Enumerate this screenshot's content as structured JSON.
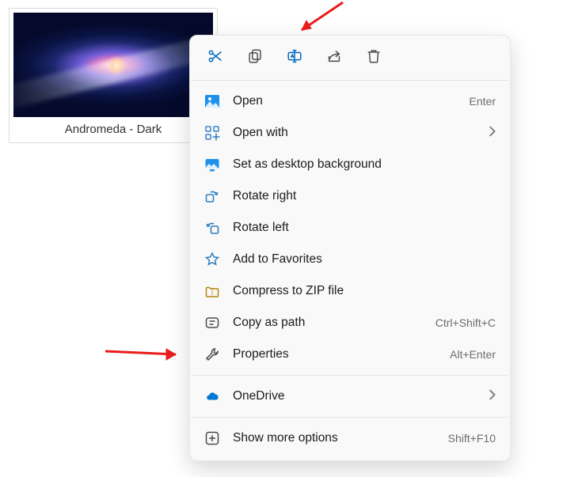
{
  "file": {
    "name": "Andromeda - Dark"
  },
  "toolbar": {
    "cut": "Cut",
    "copy": "Copy",
    "rename": "Rename",
    "share": "Share",
    "delete": "Delete"
  },
  "menu": {
    "open": {
      "label": "Open",
      "accel": "Enter"
    },
    "open_with": {
      "label": "Open with"
    },
    "set_bg": {
      "label": "Set as desktop background"
    },
    "rotate_r": {
      "label": "Rotate right"
    },
    "rotate_l": {
      "label": "Rotate left"
    },
    "favorites": {
      "label": "Add to Favorites"
    },
    "zip": {
      "label": "Compress to ZIP file"
    },
    "copy_path": {
      "label": "Copy as path",
      "accel": "Ctrl+Shift+C"
    },
    "properties": {
      "label": "Properties",
      "accel": "Alt+Enter"
    },
    "onedrive": {
      "label": "OneDrive"
    },
    "more": {
      "label": "Show more options",
      "accel": "Shift+F10"
    }
  },
  "colors": {
    "accent": "#0067c0",
    "onedrive": "#0078d4"
  }
}
